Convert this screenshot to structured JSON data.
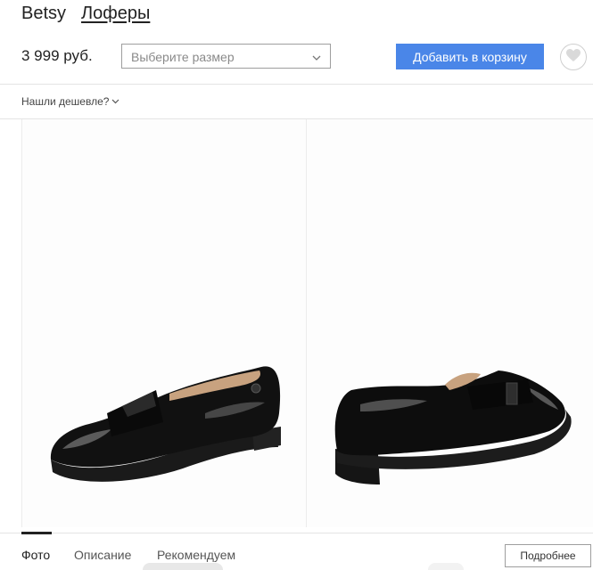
{
  "product": {
    "brand": "Betsy",
    "category": "Лоферы",
    "price": "3 999 руб.",
    "size_placeholder": "Выберите размер",
    "add_to_cart_label": "Добавить в корзину",
    "cheaper_link": "Нашли дешевле?"
  },
  "tabs": [
    {
      "label": "Фото",
      "active": true
    },
    {
      "label": "Описание",
      "active": false
    },
    {
      "label": "Рекомендуем",
      "active": false
    }
  ],
  "more_label": "Подробнее",
  "icons": {
    "favorite": "heart-icon",
    "select": "chevron-down-icon",
    "cheaper": "chevron-down-icon"
  },
  "colors": {
    "accent": "#4a86e8",
    "text": "#222222",
    "border": "#9e9e9e"
  }
}
